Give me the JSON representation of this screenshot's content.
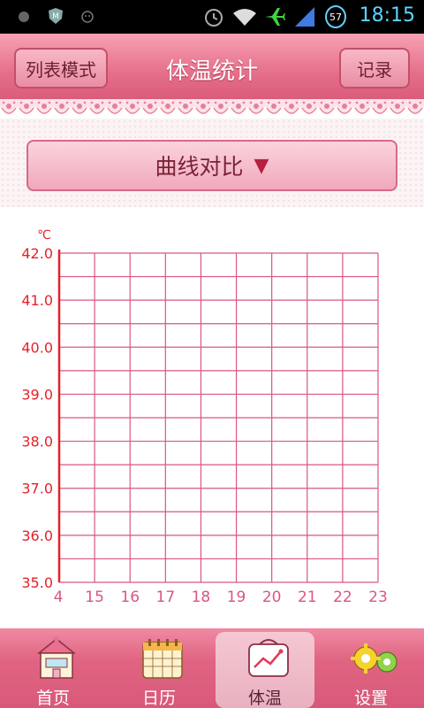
{
  "status_bar": {
    "time": "18:15",
    "battery_level": "57",
    "icons": [
      "circle-icon",
      "m-shield-icon",
      "smiley-icon",
      "alarm-icon",
      "wifi-icon",
      "airplane-icon",
      "signal-icon",
      "battery-icon"
    ]
  },
  "header": {
    "title": "体温统计",
    "left_button": "列表模式",
    "right_button": "记录"
  },
  "compare": {
    "label": "曲线对比",
    "arrow_icon": "triangle-down-icon"
  },
  "chart_data": {
    "type": "line",
    "ylabel": "℃",
    "ylim": [
      35.0,
      42.0
    ],
    "y_ticks": [
      "35.0",
      "36.0",
      "37.0",
      "38.0",
      "39.0",
      "40.0",
      "41.0",
      "42.0"
    ],
    "x_ticks": [
      "4",
      "15",
      "16",
      "17",
      "18",
      "19",
      "20",
      "21",
      "22",
      "23"
    ],
    "grid": true,
    "series": [],
    "colors": {
      "axis": "#e8202a",
      "grid": "#d9577f",
      "tick_text": "#e8202a",
      "x_tick_text": "#d9577f"
    }
  },
  "tabs": [
    {
      "label": "首页",
      "icon": "home-icon",
      "active": false
    },
    {
      "label": "日历",
      "icon": "calendar-icon",
      "active": false
    },
    {
      "label": "体温",
      "icon": "temperature-chart-icon",
      "active": true
    },
    {
      "label": "设置",
      "icon": "gear-icon",
      "active": false
    }
  ]
}
